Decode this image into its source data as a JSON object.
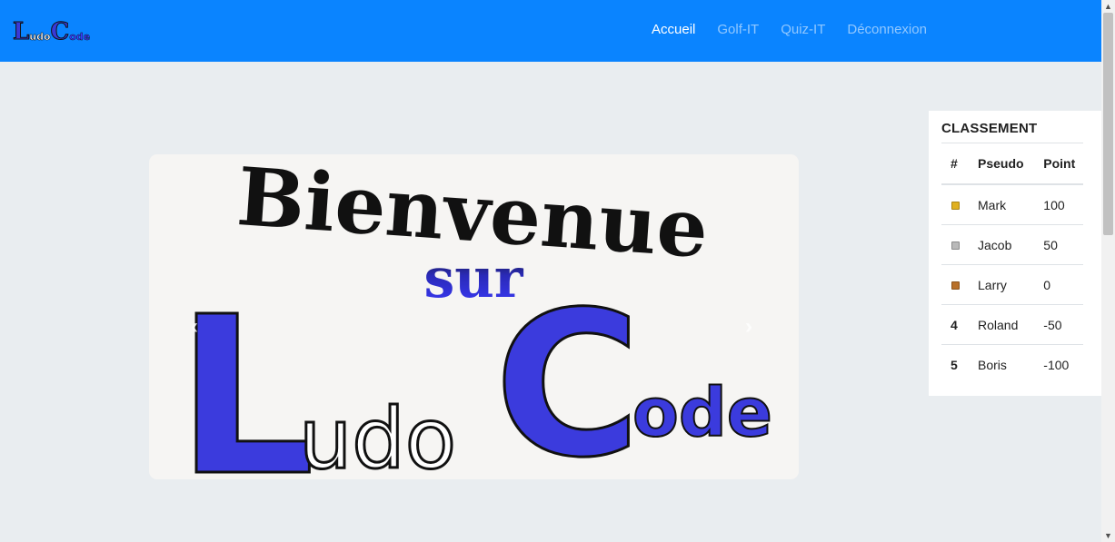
{
  "brand": {
    "big_l": "L",
    "udo": "udo",
    "big_c": "C",
    "ode": "ode"
  },
  "nav": {
    "items": [
      {
        "label": "Accueil",
        "active": true
      },
      {
        "label": "Golf-IT",
        "active": false
      },
      {
        "label": "Quiz-IT",
        "active": false
      },
      {
        "label": "Déconnexion",
        "active": false
      }
    ]
  },
  "carousel": {
    "line1": "Bienvenue",
    "line2": "sur",
    "big_l": "L",
    "udo": "udo",
    "big_c": "C",
    "ode": "ode",
    "prev_icon": "chevron-left-icon",
    "next_icon": "chevron-right-icon"
  },
  "ranking": {
    "title": "CLASSEMENT",
    "headers": {
      "rank": "#",
      "pseudo": "Pseudo",
      "point": "Point"
    },
    "rows": [
      {
        "rank": "",
        "medal": "gold-medal-icon",
        "medal_color": "#e0b020",
        "pseudo": "Mark",
        "point": "100"
      },
      {
        "rank": "",
        "medal": "silver-medal-icon",
        "medal_color": "#b9b9b9",
        "pseudo": "Jacob",
        "point": "50"
      },
      {
        "rank": "",
        "medal": "bronze-medal-icon",
        "medal_color": "#b8702a",
        "pseudo": "Larry",
        "point": "0"
      },
      {
        "rank": "4",
        "medal": "",
        "medal_color": "",
        "pseudo": "Roland",
        "point": "-50"
      },
      {
        "rank": "5",
        "medal": "",
        "medal_color": "",
        "pseudo": "Boris",
        "point": "-100"
      }
    ]
  },
  "colors": {
    "navbar": "#0a84ff",
    "logo_blue": "#3939d8"
  }
}
